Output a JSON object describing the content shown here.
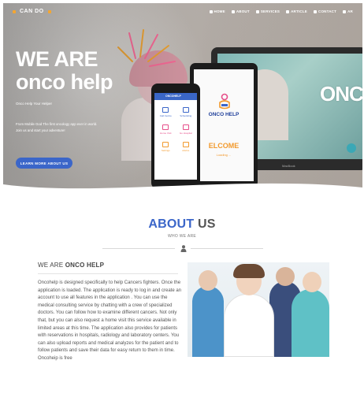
{
  "header": {
    "brand": "CAN DO",
    "nav": [
      {
        "label": "HOME",
        "icon": "home-icon"
      },
      {
        "label": "ABOUT",
        "icon": "info-icon"
      },
      {
        "label": "SERVICES",
        "icon": "services-icon"
      },
      {
        "label": "ARTICLE",
        "icon": "article-icon"
      },
      {
        "label": "CONTACT",
        "icon": "contact-icon"
      },
      {
        "label": "AR",
        "icon": "globe-icon"
      }
    ]
  },
  "hero": {
    "title_line1": "WE ARE",
    "title_line2": "onco help",
    "subtitle": "Onco Help Your Helper",
    "description": "From Mobile God The first oncology app ever in world. Join us and start your adventure!",
    "button": "LEARN MORE ABOUT US"
  },
  "devices": {
    "laptop_brand": "ONCO",
    "laptop_footer": "MacBook",
    "tablet_title": "ONCO HELP",
    "tablet_welcome": "ELCOME",
    "tablet_loading": "Loading ...",
    "phone_bar": "ONCOHELP",
    "phone_tiles": [
      {
        "label": "Call Centre",
        "icon": "phone-icon"
      },
      {
        "label": "Scheduling",
        "icon": "calendar-icon"
      },
      {
        "label": "Home Visit",
        "icon": "car-icon"
      },
      {
        "label": "Go Hospital",
        "icon": "hospital-icon"
      },
      {
        "label": "Settings",
        "icon": "gear-icon"
      },
      {
        "label": "Advice",
        "icon": "advice-icon"
      }
    ]
  },
  "about": {
    "title_accent": "ABOUT",
    "title_rest": " US",
    "subtitle": "WHO WE ARE",
    "we_are_prefix": "WE ARE ",
    "we_are_bold": "ONCO HELP",
    "body": "Oncohelp is designed specifically to help Cancers fighters. Once the application is loaded. The application is ready to log in and create an account to use all features in the application . You can use the medical consulting service by chatting with a crew of specialized doctors. You can follow how to examine different cancers. Not only that, but you can also request a home visit this service available in limited areas at this time. The application also provides for patients with reservations in hospitals, radiology and laboratory centers. You can also upload reports and medical analyzes for the patient and to follow patients and save their data for easy return to them in time. Oncoheip is free"
  },
  "colors": {
    "accent": "#3b66c9",
    "orange": "#f29a2e",
    "brand_dot": "#f4a631"
  }
}
